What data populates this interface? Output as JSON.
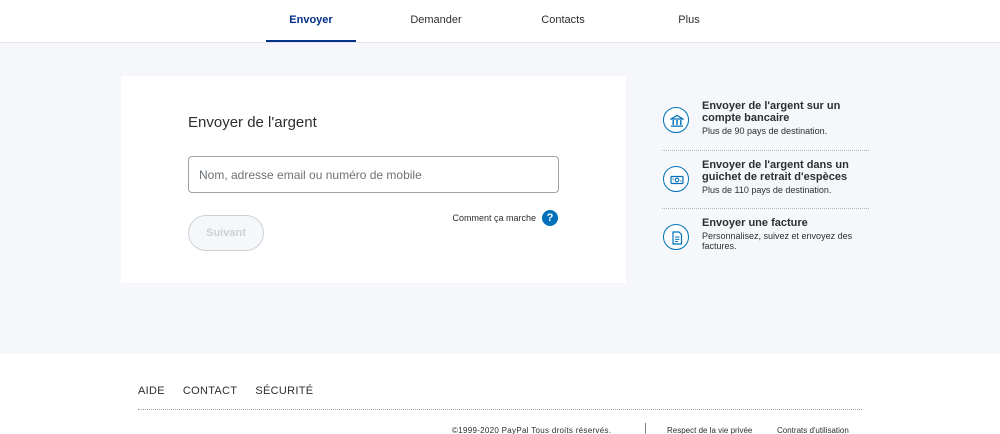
{
  "tabs": [
    {
      "label": "Envoyer",
      "active": true
    },
    {
      "label": "Demander"
    },
    {
      "label": "Contacts"
    },
    {
      "label": "Plus"
    }
  ],
  "send_card": {
    "title": "Envoyer de l'argent",
    "recipient_placeholder": "Nom, adresse email ou numéro de mobile",
    "how_it_works": "Comment ça marche",
    "next_label": "Suivant"
  },
  "side_options": [
    {
      "icon": "bank-icon",
      "title": "Envoyer de l'argent sur un compte bancaire",
      "subtitle": "Plus de 90 pays de destination."
    },
    {
      "icon": "cash-pickup-icon",
      "title": "Envoyer de l'argent dans un guichet de retrait d'espèces",
      "subtitle": "Plus de 110 pays de destination."
    },
    {
      "icon": "invoice-icon",
      "title": "Envoyer une facture",
      "subtitle": "Personnalisez, suivez et envoyez des factures."
    }
  ],
  "footer": {
    "links": [
      "AIDE",
      "CONTACT",
      "SÉCURITÉ"
    ],
    "copyright": "©1999-2020 PayPal Tous droits réservés.",
    "privacy": "Respect de la vie privée",
    "terms": "Contrats d'utilisation"
  },
  "colors": {
    "accent": "#003087",
    "link": "#0070ba",
    "background": "#f5f7fa"
  }
}
